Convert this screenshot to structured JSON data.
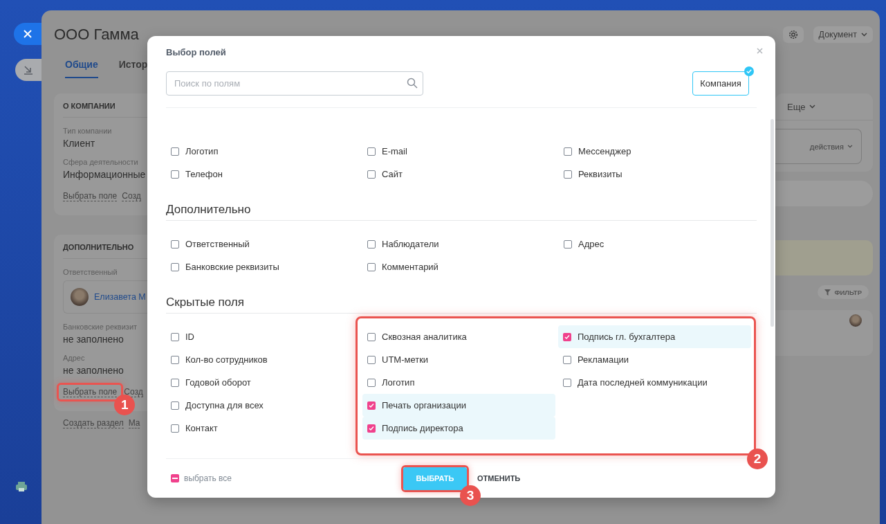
{
  "page": {
    "title": "ООО Гамма",
    "tabs": [
      {
        "label": "Общие",
        "selected": true
      },
      {
        "label": "Истор",
        "selected": false
      }
    ],
    "header_buttons": [
      {
        "kind": "gear"
      },
      {
        "kind": "dropdown",
        "label": "Документ"
      }
    ],
    "sections": [
      {
        "title": "О КОМПАНИИ",
        "fields": [
          {
            "kind": "text",
            "label": "Тип компании",
            "value": "Клиент"
          },
          {
            "kind": "text",
            "label": "Сфера деятельности",
            "value": "Информационные"
          }
        ],
        "links": [
          {
            "label": "Выбрать поле"
          },
          {
            "label": "Созд"
          }
        ]
      },
      {
        "title": "ДОПОЛНИТЕЛЬНО",
        "fields": [
          {
            "kind": "user",
            "label": "Ответственный",
            "value": "Елизавета М"
          },
          {
            "kind": "text",
            "label": "Банковские реквизит",
            "value": "не заполнено"
          },
          {
            "kind": "text",
            "label": "Адрес",
            "value": "не заполнено"
          }
        ],
        "links": [
          {
            "label": "Выбрать поле",
            "marker": "1"
          },
          {
            "label": "Созд"
          }
        ]
      }
    ],
    "footer_links": [
      "Создать раздел",
      "Ма"
    ],
    "right_panel": {
      "more_menu": "Еще",
      "actions_button": "действия",
      "filter_button": "ФИЛЬТР"
    }
  },
  "modal": {
    "title": "Выбор полей",
    "search": {
      "placeholder": "Поиск по полям"
    },
    "entity_button": {
      "label": "Компания",
      "selected": true
    },
    "groups": [
      {
        "columns": [
          [
            {
              "label": "Логотип",
              "checked": false
            },
            {
              "label": "Телефон",
              "checked": false
            }
          ],
          [
            {
              "label": "E-mail",
              "checked": false
            },
            {
              "label": "Сайт",
              "checked": false
            }
          ],
          [
            {
              "label": "Мессенджер",
              "checked": false
            },
            {
              "label": "Реквизиты",
              "checked": false
            }
          ]
        ]
      },
      {
        "title": "Дополнительно",
        "columns": [
          [
            {
              "label": "Ответственный",
              "checked": false
            },
            {
              "label": "Банковские реквизиты",
              "checked": false
            }
          ],
          [
            {
              "label": "Наблюдатели",
              "checked": false
            },
            {
              "label": "Комментарий",
              "checked": false
            }
          ],
          [
            {
              "label": "Адрес",
              "checked": false
            }
          ]
        ]
      },
      {
        "title": "Скрытые поля",
        "marker": "2",
        "columns": [
          [
            {
              "label": "ID",
              "checked": false
            },
            {
              "label": "Кол-во сотрудников",
              "checked": false
            },
            {
              "label": "Годовой оборот",
              "checked": false
            },
            {
              "label": "Доступна для всех",
              "checked": false
            },
            {
              "label": "Контакт",
              "checked": false
            }
          ],
          [
            {
              "label": "Сквозная аналитика",
              "checked": false
            },
            {
              "label": "UTM-метки",
              "checked": false
            },
            {
              "label": "Логотип",
              "checked": false
            },
            {
              "label": "Печать организации",
              "checked": true
            },
            {
              "label": "Подпись директора",
              "checked": true
            }
          ],
          [
            {
              "label": "Подпись гл. бухгалтера",
              "checked": true
            },
            {
              "label": "Рекламации",
              "checked": false
            },
            {
              "label": "Дата последней коммуникации",
              "checked": false
            }
          ]
        ]
      }
    ],
    "select_all": {
      "label": "выбрать все",
      "indeterminate": true
    },
    "buttons": [
      {
        "kind": "primary",
        "label": "ВЫБРАТЬ",
        "marker": "3"
      },
      {
        "kind": "link",
        "label": "ОТМЕНИТЬ"
      }
    ]
  }
}
